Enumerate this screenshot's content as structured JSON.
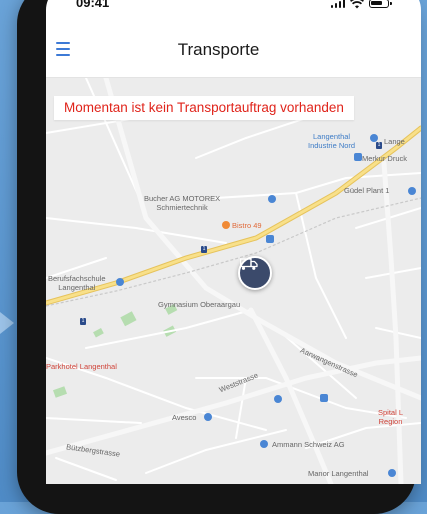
{
  "status_bar": {
    "time": "09:41"
  },
  "header": {
    "title": "Transporte"
  },
  "map": {
    "banner": "Momentan ist kein Transportauftrag vorhanden",
    "labels": {
      "industrie_nord_1": "Langenthal",
      "industrie_nord_2": "Industrie Nord",
      "merkur": "Merkur Druck",
      "langenthal_tr": "Lange",
      "gudel": "Güdel Plant 1",
      "bucher_1": "Bucher AG MOTOREX",
      "bucher_2": "Schmiertechnik",
      "bistro": "Bistro 49",
      "berufsfach_1": "Berufsfachschule",
      "berufsfach_2": "Langenthal",
      "gymnasium": "Gymnasium Oberaargau",
      "parkhotel": "Parkhotel Langenthal",
      "avesco": "Avesco",
      "ammann": "Ammann Schweiz AG",
      "spital_1": "Spital L",
      "spital_2": "Region",
      "manor": "Manor Langenthal",
      "street_1": "Bützbergstrasse",
      "street_2": "Aarwangenstrasse",
      "street_3": "Weststrasse"
    }
  },
  "colors": {
    "accent": "#3d7ad6",
    "banner_text": "#e0241b",
    "highway": "#f6d77a",
    "park": "#b6ddb0",
    "truck_marker": "#3b4a6b"
  },
  "icons": {
    "menu": "hamburger-menu-icon",
    "truck": "truck-icon",
    "wifi": "wifi-icon",
    "battery": "battery-icon",
    "signal": "cellular-signal-icon"
  }
}
